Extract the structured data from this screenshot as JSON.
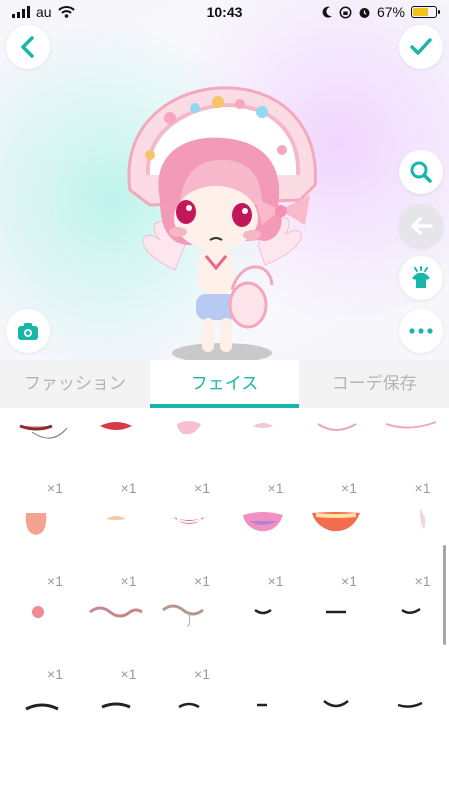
{
  "status_bar": {
    "carrier": "au",
    "time": "10:43",
    "battery_percent": "67%",
    "battery_level": 0.67,
    "battery_color": "#f2c41a"
  },
  "icons": {
    "back": "chevron-left-icon",
    "confirm": "checkmark-icon",
    "search": "magnifier-icon",
    "undo": "arrow-left-icon",
    "outfit": "shirt-sparkle-icon",
    "more": "ellipsis-icon",
    "camera": "camera-icon"
  },
  "accent_color": "#16b6aa",
  "tabs": [
    {
      "label": "ファッション",
      "active": false
    },
    {
      "label": "フェイス",
      "active": true
    },
    {
      "label": "コーデ保存",
      "active": false
    }
  ],
  "items": [
    {
      "kind": "mouth-open-chin",
      "qty": "×1"
    },
    {
      "kind": "lips-red",
      "qty": "×1"
    },
    {
      "kind": "lips-pink-pout",
      "qty": "×1"
    },
    {
      "kind": "lips-small-pink",
      "qty": "×1"
    },
    {
      "kind": "smile-thin-pink",
      "qty": "×1"
    },
    {
      "kind": "smile-wide-pink",
      "qty": "×1"
    },
    {
      "kind": "tongue-out",
      "qty": "×1"
    },
    {
      "kind": "small-peach-mouth",
      "qty": "×1"
    },
    {
      "kind": "grin-pink",
      "qty": "×1"
    },
    {
      "kind": "open-mouth-purple",
      "qty": "×1"
    },
    {
      "kind": "open-mouth-wide",
      "qty": "×1"
    },
    {
      "kind": "tiny-pink-tongue",
      "qty": "×1"
    },
    {
      "kind": "small-round-mouth",
      "qty": "×1"
    },
    {
      "kind": "wavy-mouth",
      "qty": "×1"
    },
    {
      "kind": "wavy-mouth-drool",
      "qty": "×1"
    },
    {
      "kind": "smile-line-1",
      "qty": ""
    },
    {
      "kind": "flat-line",
      "qty": ""
    },
    {
      "kind": "smile-line-2",
      "qty": ""
    },
    {
      "kind": "frown-line-1",
      "qty": ""
    },
    {
      "kind": "frown-line-2",
      "qty": ""
    },
    {
      "kind": "frown-line-3",
      "qty": ""
    },
    {
      "kind": "dash-line",
      "qty": ""
    },
    {
      "kind": "v-line",
      "qty": ""
    },
    {
      "kind": "smirk-line",
      "qty": ""
    }
  ]
}
